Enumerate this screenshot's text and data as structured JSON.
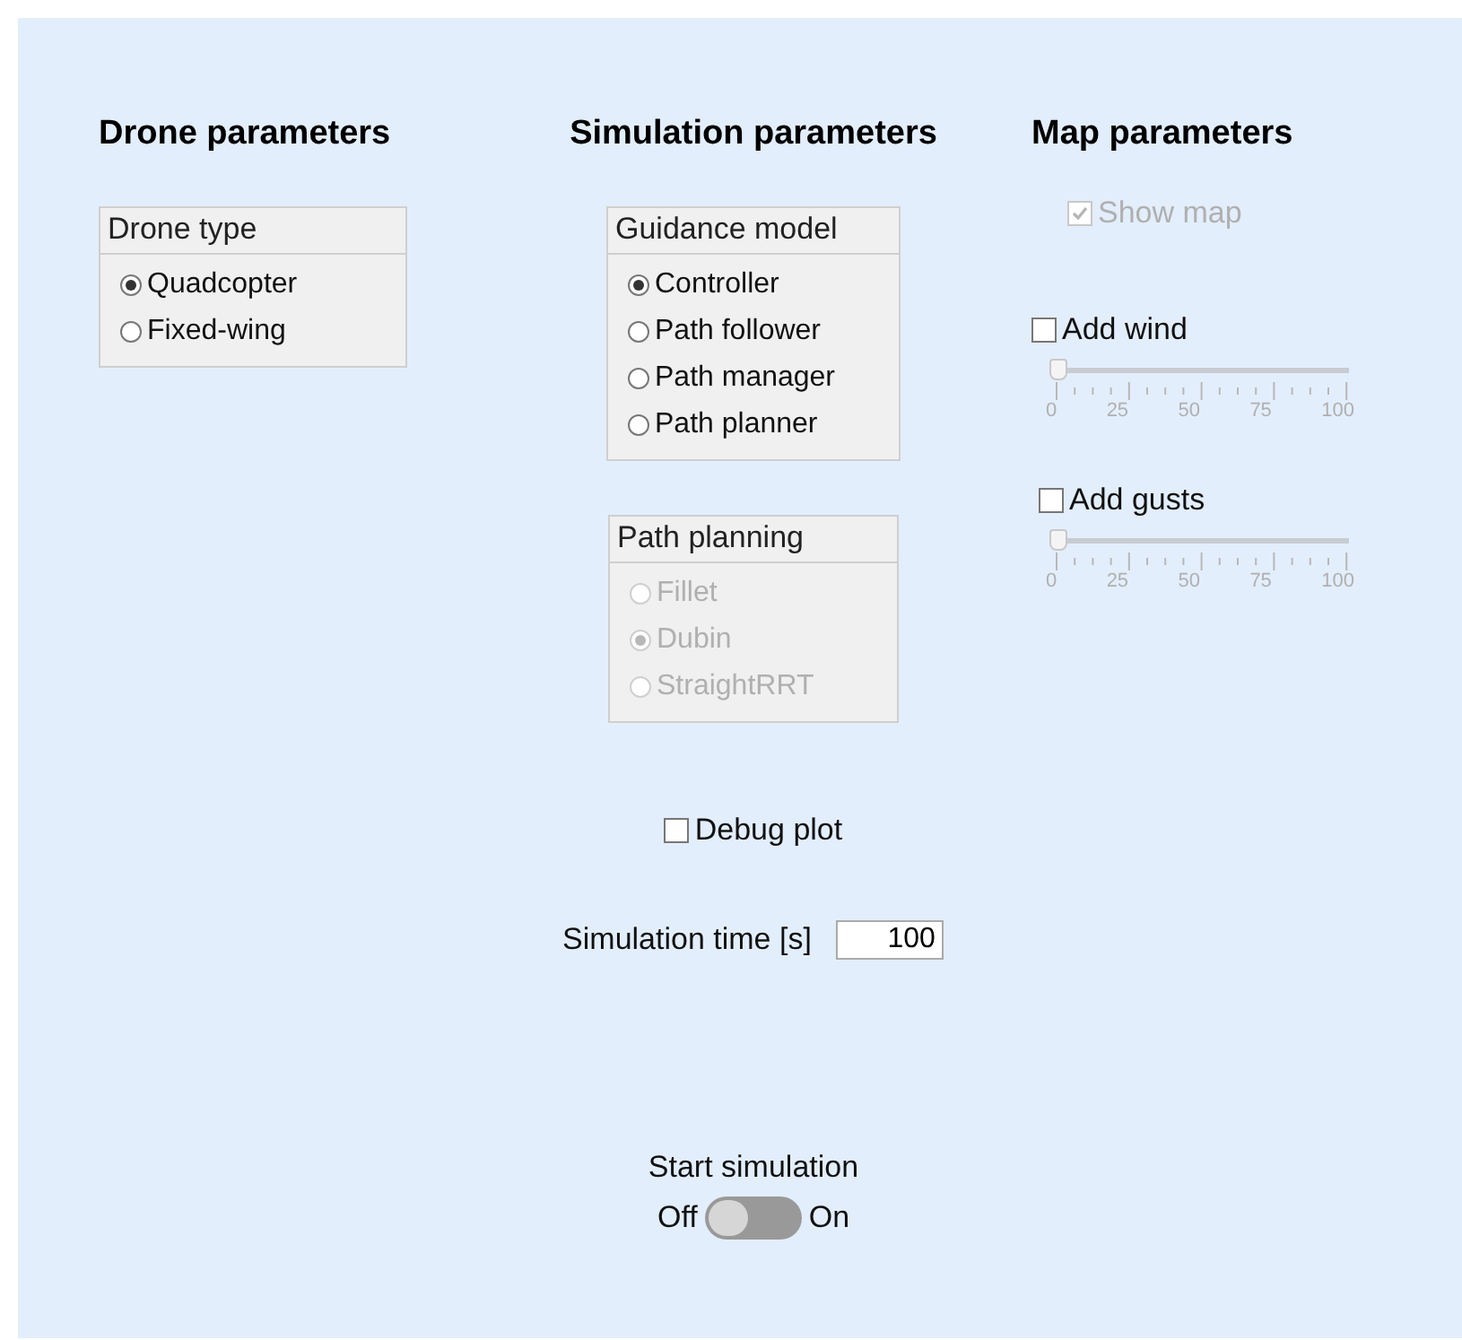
{
  "drone": {
    "heading": "Drone parameters",
    "drone_type": {
      "title": "Drone type",
      "disabled": false,
      "options": [
        {
          "label": "Quadcopter",
          "selected": true
        },
        {
          "label": "Fixed-wing",
          "selected": false
        }
      ]
    }
  },
  "simulation": {
    "heading": "Simulation parameters",
    "guidance_model": {
      "title": "Guidance model",
      "disabled": false,
      "options": [
        {
          "label": "Controller",
          "selected": true
        },
        {
          "label": "Path follower",
          "selected": false
        },
        {
          "label": "Path manager",
          "selected": false
        },
        {
          "label": "Path planner",
          "selected": false
        }
      ]
    },
    "path_planning": {
      "title": "Path planning",
      "disabled": true,
      "options": [
        {
          "label": "Fillet",
          "selected": false
        },
        {
          "label": "Dubin",
          "selected": true
        },
        {
          "label": "StraightRRT",
          "selected": false
        }
      ]
    },
    "debug_plot": {
      "label": "Debug plot",
      "checked": false
    },
    "simulation_time": {
      "label": "Simulation time [s]",
      "value": "100"
    },
    "start_simulation": {
      "label": "Start simulation",
      "off_label": "Off",
      "on_label": "On",
      "on": false
    }
  },
  "map": {
    "heading": "Map parameters",
    "show_map": {
      "label": "Show map",
      "checked": true,
      "disabled": true
    },
    "sliders": [
      {
        "label": "Add wind",
        "checked": false,
        "level": 0,
        "scale": [
          "0",
          "25",
          "50",
          "75",
          "100"
        ]
      },
      {
        "label": "Add gusts",
        "checked": false,
        "level": 0,
        "scale": [
          "0",
          "25",
          "50",
          "75",
          "100"
        ]
      }
    ]
  }
}
